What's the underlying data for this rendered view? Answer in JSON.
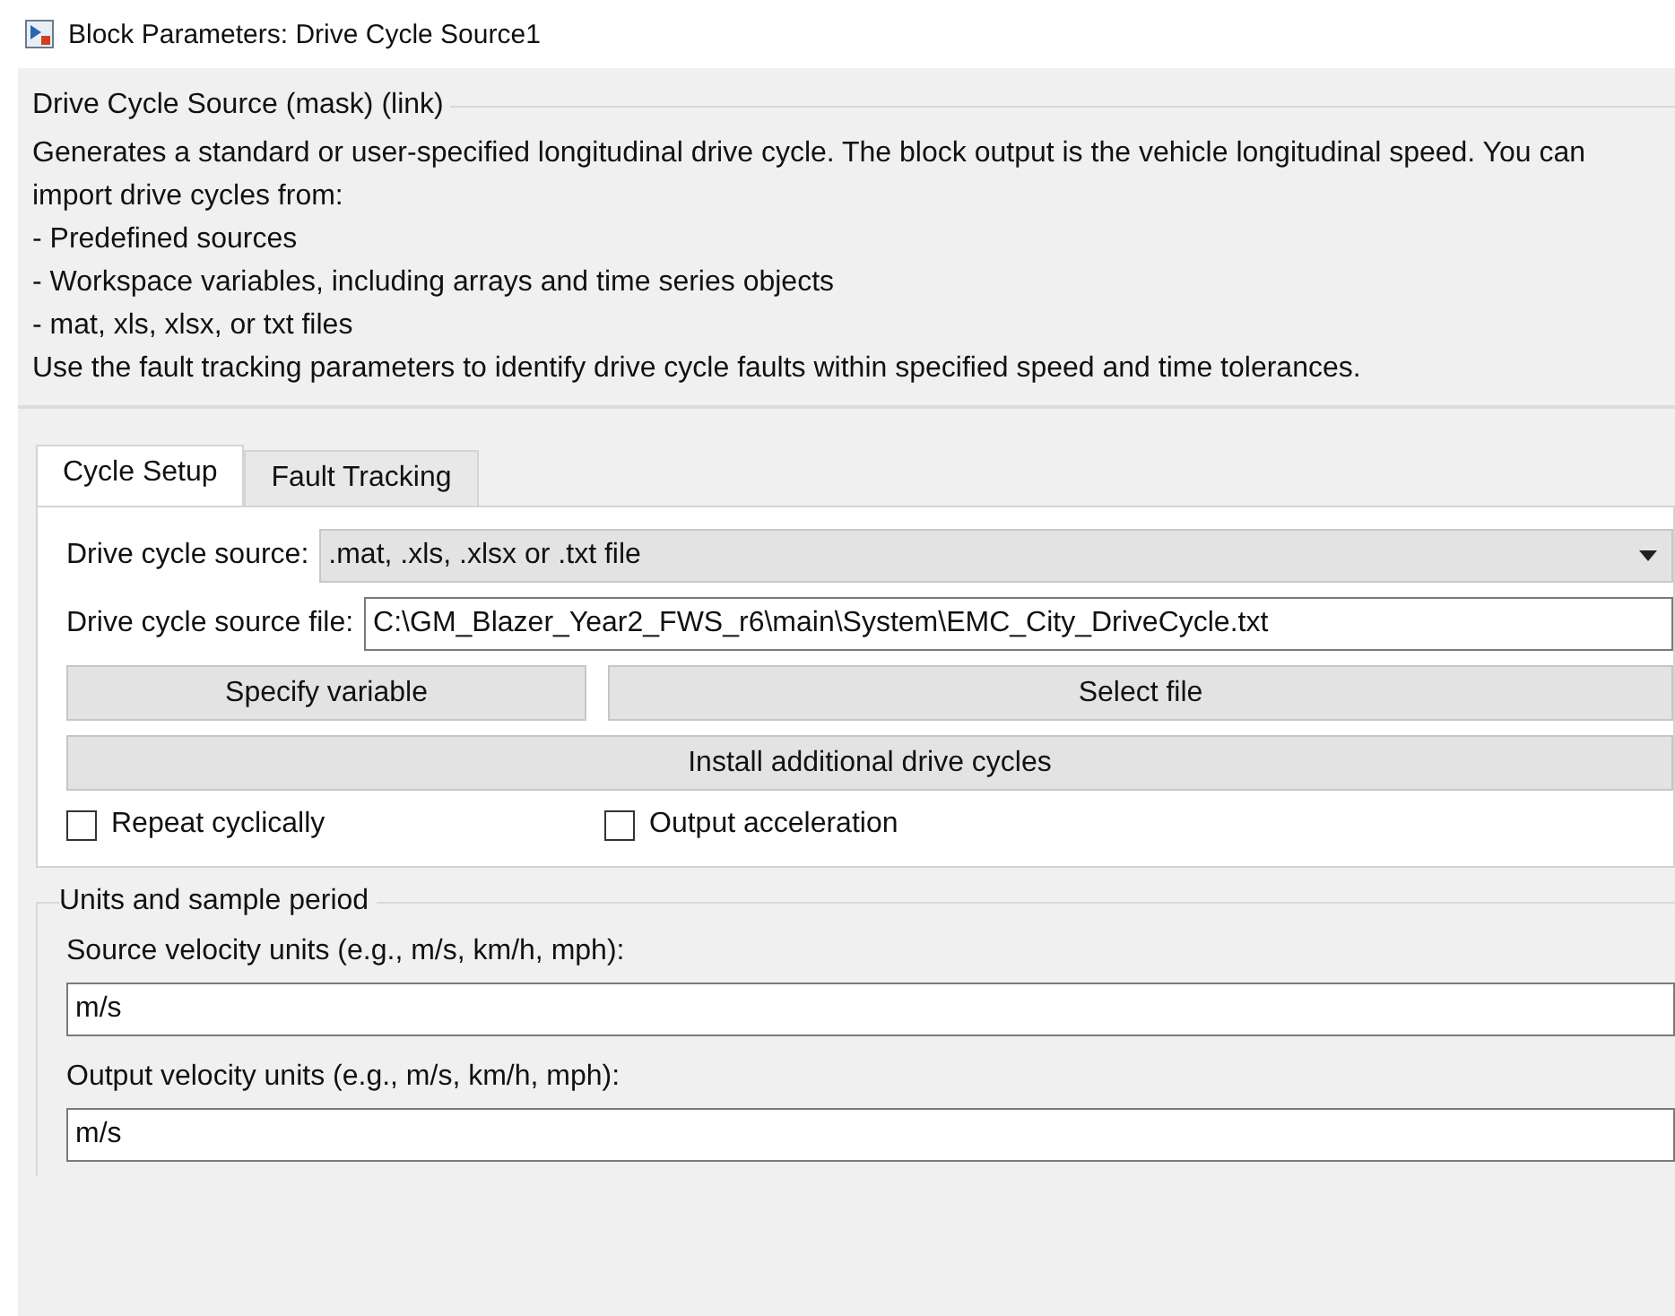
{
  "window": {
    "title": "Block Parameters: Drive Cycle Source1"
  },
  "mask_group": {
    "title": "Drive Cycle Source (mask) (link)",
    "description": [
      "Generates a standard or user-specified longitudinal drive cycle. The block output is the vehicle longitudinal speed. You can import drive cycles from:",
      "- Predefined sources",
      "- Workspace variables, including arrays and time series objects",
      "- mat, xls, xlsx, or txt files",
      "Use the fault tracking parameters to identify drive cycle faults within specified speed and time tolerances."
    ]
  },
  "tabs": [
    {
      "label": "Cycle Setup",
      "selected": true
    },
    {
      "label": "Fault Tracking",
      "selected": false
    }
  ],
  "cycle_setup": {
    "source_label": "Drive cycle source:",
    "source_value": ".mat, .xls, .xlsx or .txt file",
    "file_label": "Drive cycle source file:",
    "file_value": "C:\\GM_Blazer_Year2_FWS_r6\\main\\System\\EMC_City_DriveCycle.txt",
    "buttons": [
      "Specify variable",
      "Select file"
    ],
    "wide_button": "Install additional drive cycles",
    "checkboxes": [
      {
        "label": "Repeat cyclically",
        "checked": false
      },
      {
        "label": "Output acceleration",
        "checked": false
      }
    ]
  },
  "units_group": {
    "title": "Units and sample period",
    "fields": [
      {
        "label": "Source velocity units (e.g., m/s, km/h, mph):",
        "value": "m/s"
      },
      {
        "label": "Output velocity units (e.g., m/s, km/h, mph):",
        "value": "m/s"
      }
    ]
  }
}
